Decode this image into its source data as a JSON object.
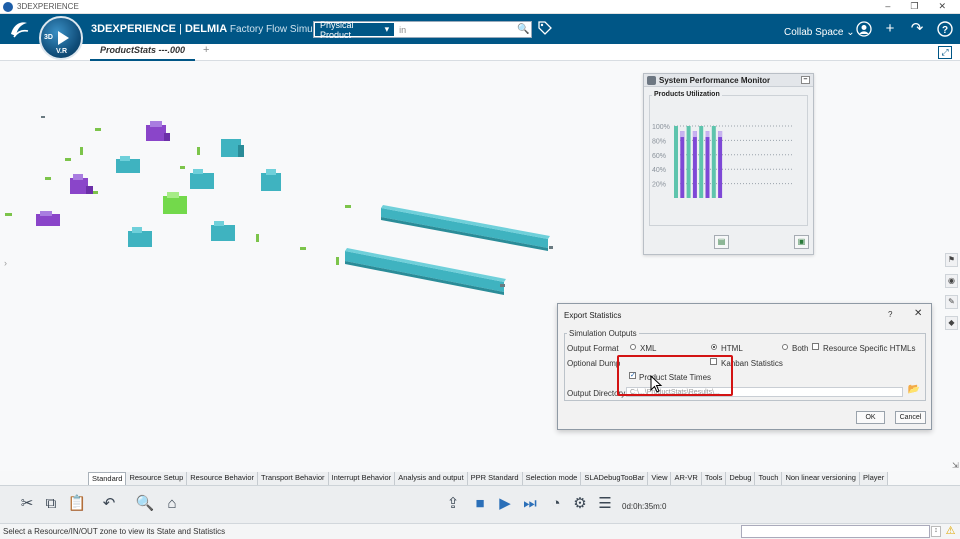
{
  "os": {
    "title": "3DEXPERIENCE",
    "min": "–",
    "restore": "❐",
    "close": "✕"
  },
  "header": {
    "brand_a": "3DEXPERIENCE",
    "brand_sep": " | ",
    "brand_b": "DELMIA",
    "brand_c": " Factory Flow Simulation",
    "compass_q1": "3D",
    "compass_q2": "V.R",
    "search_scope": "Physical Product",
    "search_scope_arrow": "▾",
    "search_value": "in",
    "collab_space": "Collab Space",
    "collab_arrow": "⌄"
  },
  "tabs": {
    "active_label": "ProductStats ---.000",
    "add": "+"
  },
  "monitor": {
    "title": "System Performance Monitor",
    "group_label": "Products Utilization",
    "y_ticks": [
      "100%",
      "80%",
      "60%",
      "40%",
      "20%"
    ],
    "bars": [
      {
        "series": "green",
        "value": 100
      },
      {
        "series": "purple",
        "value": 93
      },
      {
        "series": "green",
        "value": 100
      },
      {
        "series": "purple",
        "value": 93
      },
      {
        "series": "green",
        "value": 100
      },
      {
        "series": "purple",
        "value": 93
      },
      {
        "series": "green",
        "value": 100
      },
      {
        "series": "purple",
        "value": 93
      }
    ],
    "colors": {
      "purple": "#7e48d6",
      "purple_light": "#c7b2f0",
      "green": "#5ec4ad"
    }
  },
  "dialog": {
    "title": "Export Statistics",
    "help": "?",
    "close": "✕",
    "group_label": "Simulation Outputs",
    "output_format_label": "Output Format",
    "opt_xml": "XML",
    "opt_html": "HTML",
    "opt_both": "Both",
    "opt_resource_html": "Resource Specific HTMLs",
    "optional_dump_label": "Optional Dump",
    "kanban_label": "Kanban Statistics",
    "product_state_label": "Product State Times",
    "output_dir_label": "Output Directory",
    "output_dir_value": "C:\\...\\ProductStats\\Results\\...",
    "ok": "OK",
    "cancel": "Cancel",
    "check_mark": "✓"
  },
  "action_tabs": [
    "Standard",
    "Resource Setup",
    "Resource Behavior",
    "Transport Behavior",
    "Interrupt Behavior",
    "Analysis and output",
    "PPR Standard",
    "Selection mode",
    "SLADebugTooBar",
    "View",
    "AR-VR",
    "Tools",
    "Debug",
    "Touch",
    "Non linear versioning",
    "Player"
  ],
  "toolbar": {
    "sim_time": "0d:0h:35m:0"
  },
  "status": {
    "message": "Select a Resource/IN/OUT zone to view its State and Statistics"
  },
  "icons": {
    "minimize": "–",
    "search": "🔍",
    "add": "+",
    "share": "↷",
    "help": "?",
    "fullscreen": "⤢",
    "cut": "✂",
    "copy": "⧉",
    "paste": "📋",
    "undo": "↶",
    "zoom": "🔍",
    "tree": "⌂",
    "export": "⇪",
    "stop": "■",
    "play": "▶",
    "step": "⏭",
    "speed": "◔",
    "settings": "⚙",
    "list": "☰",
    "monitor_btn1": "▤",
    "monitor_btn2": "▣",
    "folder": "📂",
    "side1": "⚑",
    "side2": "◉",
    "side3": "✎",
    "side4": "◆",
    "chevron_right": "›",
    "small_arrow": "⇲",
    "status_btn": "↕",
    "warning": "⚠"
  },
  "colors": {
    "header_bg": "#005686",
    "highlight_red": "#d31313",
    "teal_shape": "#3fb3c0",
    "purple_shape": "#8a45c9",
    "green_shape": "#73d94b"
  }
}
